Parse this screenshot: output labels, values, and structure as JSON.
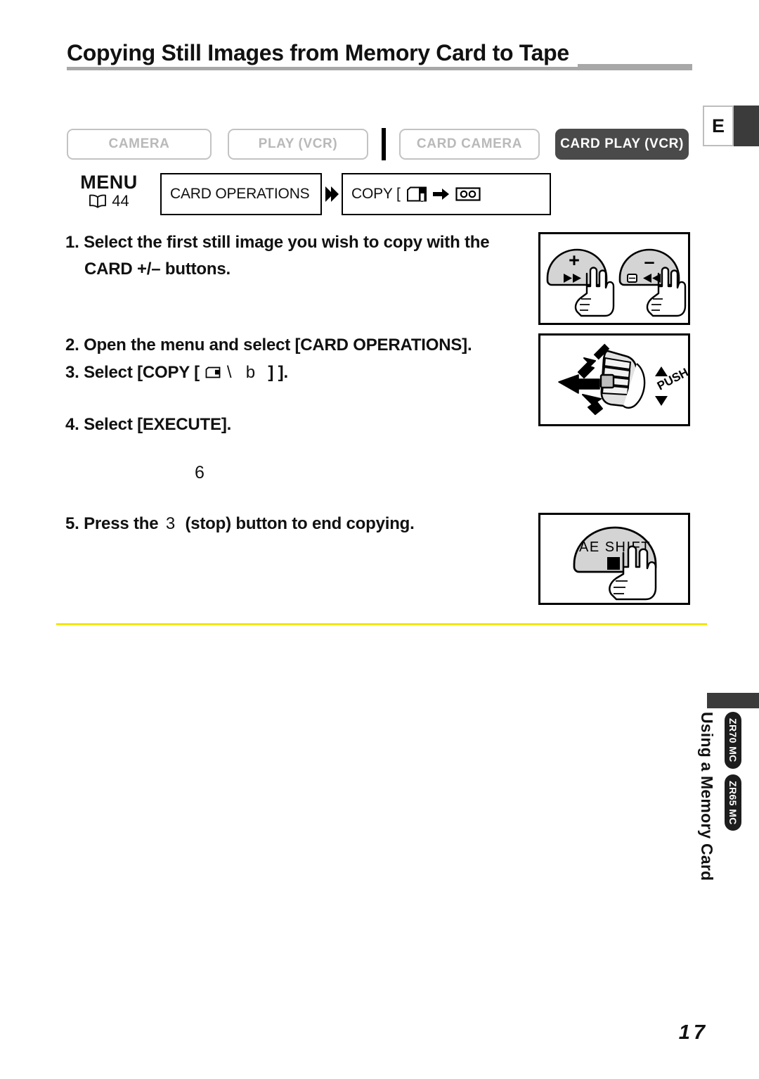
{
  "page_title": "Copying Still Images from Memory Card to Tape",
  "lang_tab": {
    "letter": "E"
  },
  "modes": [
    {
      "label": "CAMERA",
      "active": false
    },
    {
      "label": "PLAY (VCR)",
      "active": false
    },
    {
      "label": "CARD CAMERA",
      "active": false
    },
    {
      "label": "CARD PLAY (VCR)",
      "active": true
    }
  ],
  "menu": {
    "label": "MENU",
    "page_ref": "44",
    "box1": "CARD OPERATIONS",
    "box2_prefix": "COPY [",
    "box2_icons": "card-to-tape"
  },
  "steps": {
    "s1_num": "1.",
    "s1_line1": "Select the first still image you wish to copy with the",
    "s1_line2": "CARD +/– buttons.",
    "s2_num": "2.",
    "s2_text": "Open the menu and select [CARD OPERATIONS].",
    "s3_num": "3.",
    "s3_prefix": "Select [COPY [",
    "s3_glyph1": "\\",
    "s3_glyph2": "b",
    "s3_suffix": "] ].",
    "s4_num": "4.",
    "s4_text": "Select [EXECUTE].",
    "stray_marker": "6",
    "s5_num": "5.",
    "s5_prefix": "Press the",
    "s5_glyph": "3",
    "s5_suffix": "(stop) button to end copying."
  },
  "illustrations": {
    "card_buttons": {
      "plus_label": "+",
      "plus_sub": "▶▶",
      "minus_label": "–",
      "minus_sub": "◀◀"
    },
    "dial": {
      "push_label": "PUSH"
    },
    "ae_shift": {
      "label": "AE SHIFT"
    }
  },
  "sidebar": {
    "section_title": "Using a Memory Card",
    "badges": [
      "ZR70 MC",
      "ZR65 MC"
    ]
  },
  "page_number": "17",
  "colors": {
    "active_tab": "#4a4a4a",
    "inactive_tab_text": "#b9b9b9",
    "title_rule": "#a8a8a8",
    "yellow_rule": "#f5e400",
    "dark_block": "#3b3b3b"
  }
}
